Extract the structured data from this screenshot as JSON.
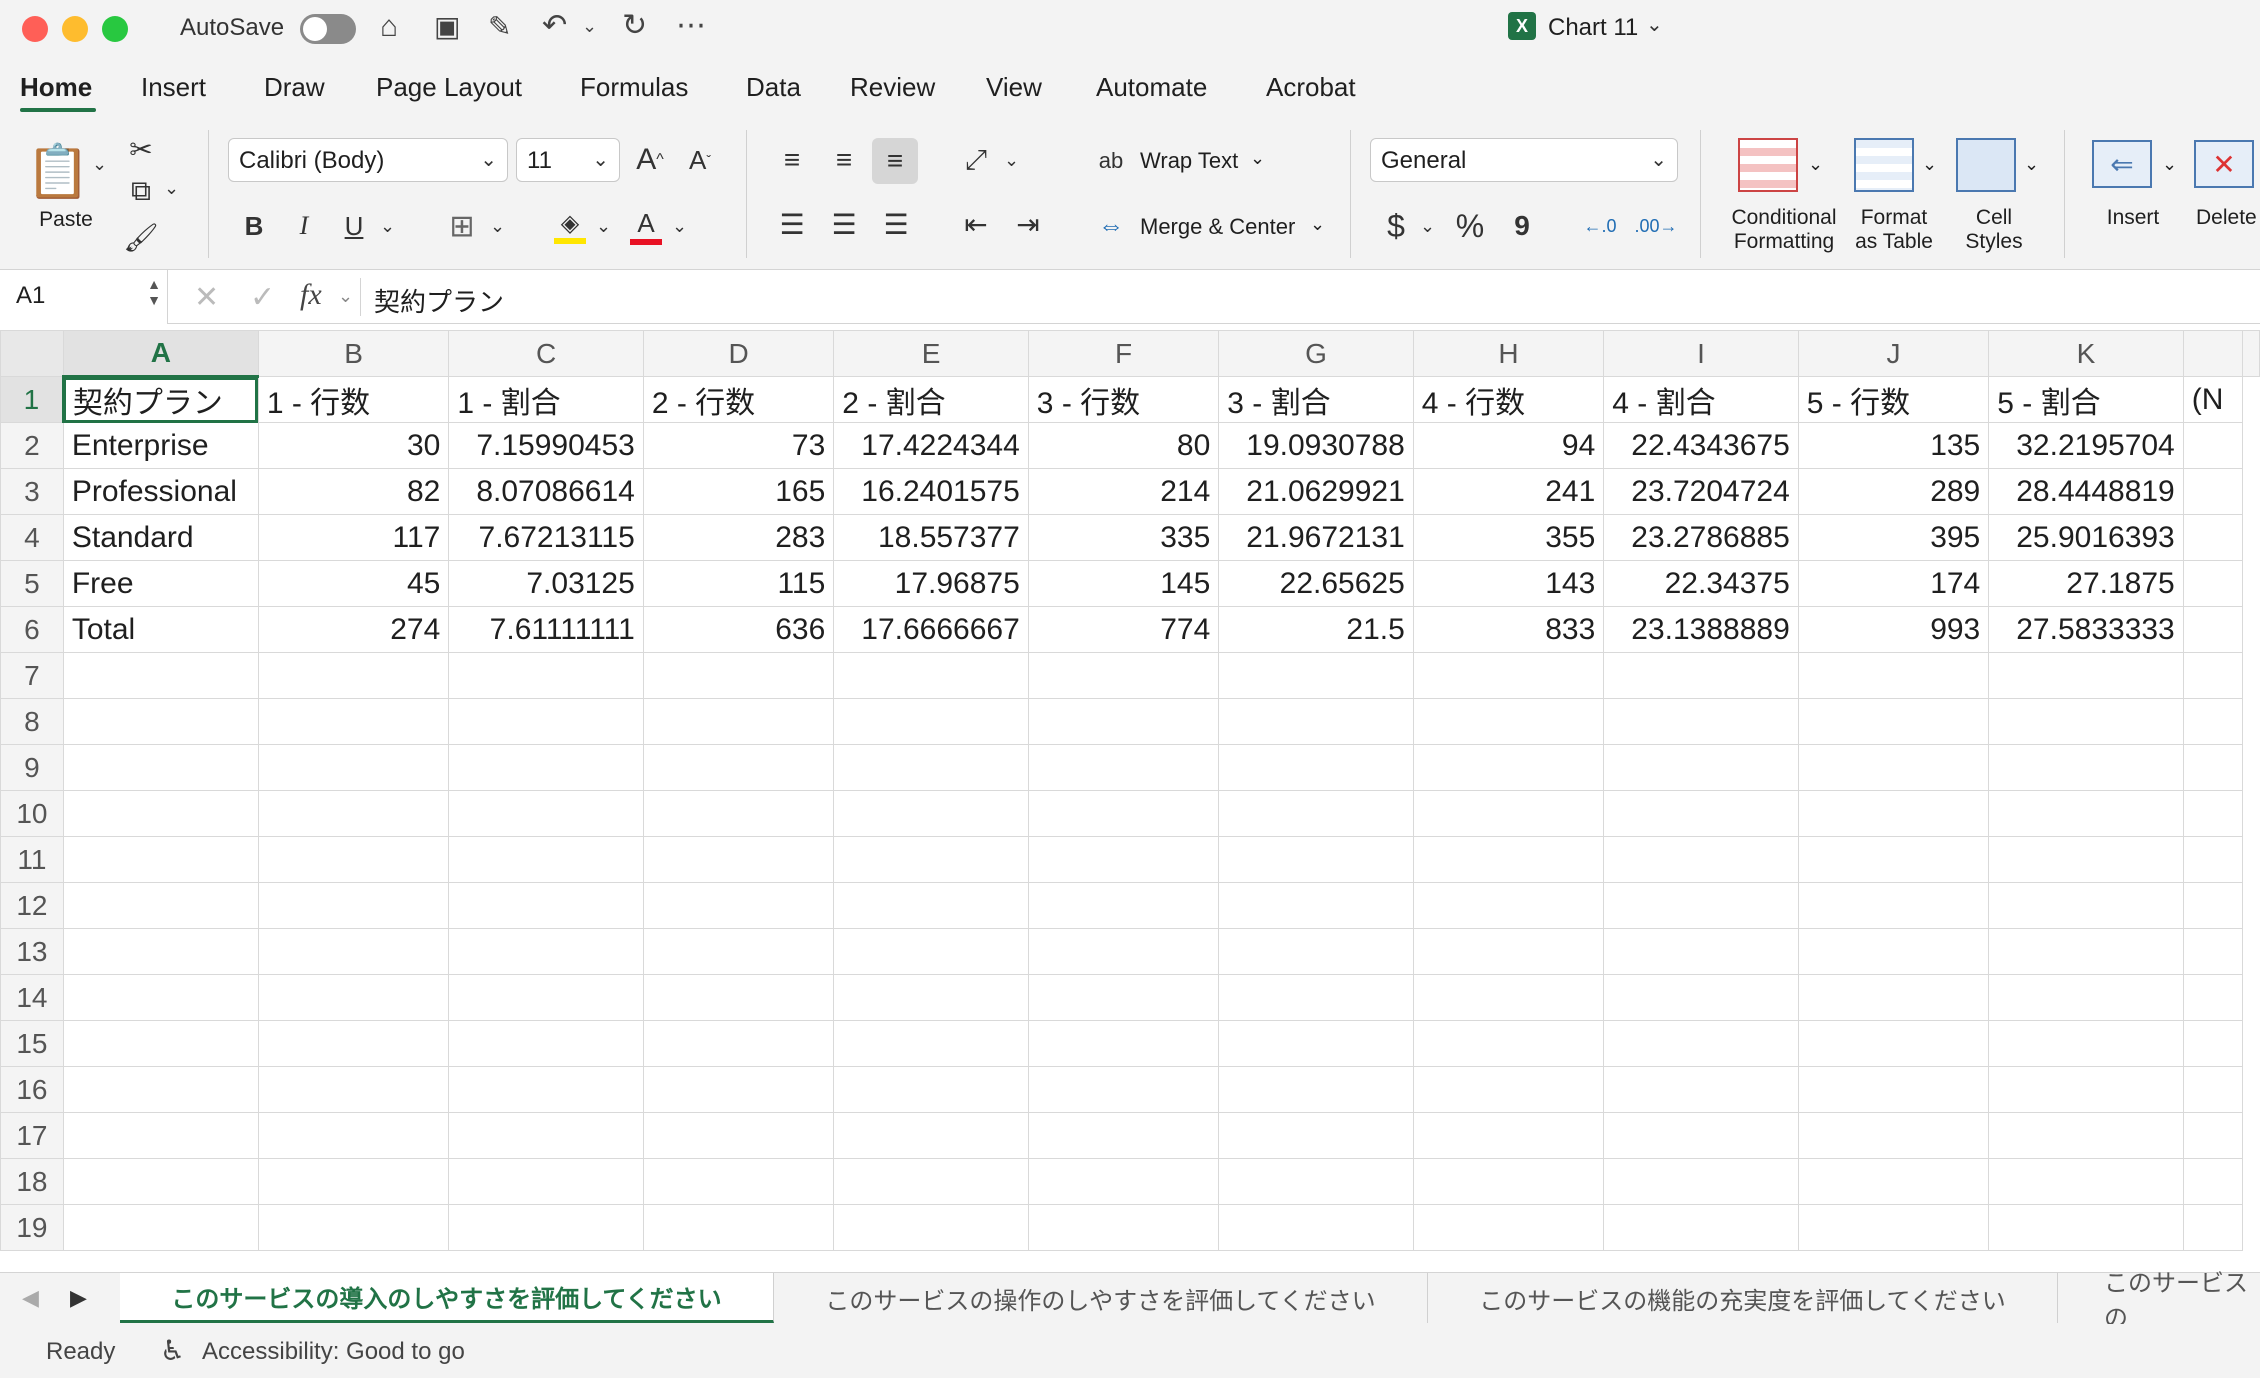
{
  "titlebar": {
    "autosave_label": "AutoSave",
    "document_title": "Chart 11",
    "colors": {
      "close": "#ff5f57",
      "minimize": "#febc2e",
      "maximize": "#28c840"
    }
  },
  "tabs": [
    "Home",
    "Insert",
    "Draw",
    "Page Layout",
    "Formulas",
    "Data",
    "Review",
    "View",
    "Automate",
    "Acrobat"
  ],
  "ribbon": {
    "paste_label": "Paste",
    "font_name": "Calibri (Body)",
    "font_size": "11",
    "wrap_text_label": "Wrap Text",
    "merge_center_label": "Merge & Center",
    "number_format": "General",
    "conditional_formatting_label": "Conditional\nFormatting",
    "format_as_table_label": "Format\nas Table",
    "cell_styles_label": "Cell\nStyles",
    "insert_label": "Insert",
    "delete_label": "Delete",
    "bold": "B",
    "italic": "I",
    "underline": "U",
    "currency": "$",
    "percent": "%",
    "comma": "9"
  },
  "formula_bar": {
    "name_box": "A1",
    "fx": "fx",
    "content": "契約プラン"
  },
  "columns": [
    "A",
    "B",
    "C",
    "D",
    "E",
    "F",
    "G",
    "H",
    "I",
    "J",
    "K"
  ],
  "rows": [
    [
      "契約プラン",
      "1 - 行数",
      "1 - 割合",
      "2 - 行数",
      "2 - 割合",
      "3 - 行数",
      "3 - 割合",
      "4 - 行数",
      "4 - 割合",
      "5 - 行数",
      "5 - 割合",
      "(N"
    ],
    [
      "Enterprise",
      "30",
      "7.15990453",
      "73",
      "17.4224344",
      "80",
      "19.0930788",
      "94",
      "22.4343675",
      "135",
      "32.2195704",
      ""
    ],
    [
      "Professional",
      "82",
      "8.07086614",
      "165",
      "16.2401575",
      "214",
      "21.0629921",
      "241",
      "23.7204724",
      "289",
      "28.4448819",
      ""
    ],
    [
      "Standard",
      "117",
      "7.67213115",
      "283",
      "18.557377",
      "335",
      "21.9672131",
      "355",
      "23.2786885",
      "395",
      "25.9016393",
      ""
    ],
    [
      "Free",
      "45",
      "7.03125",
      "115",
      "17.96875",
      "145",
      "22.65625",
      "143",
      "22.34375",
      "174",
      "27.1875",
      ""
    ],
    [
      "Total",
      "274",
      "7.61111111",
      "636",
      "17.6666667",
      "774",
      "21.5",
      "833",
      "23.1388889",
      "993",
      "27.5833333",
      ""
    ]
  ],
  "total_rows_visible": 19,
  "sheets": [
    "このサービスの導入のしやすさを評価してください",
    "このサービスの操作のしやすさを評価してください",
    "このサービスの機能の充実度を評価してください",
    "このサービスの"
  ],
  "status": {
    "ready": "Ready",
    "accessibility": "Accessibility: Good to go"
  },
  "accent_color": "#217346"
}
